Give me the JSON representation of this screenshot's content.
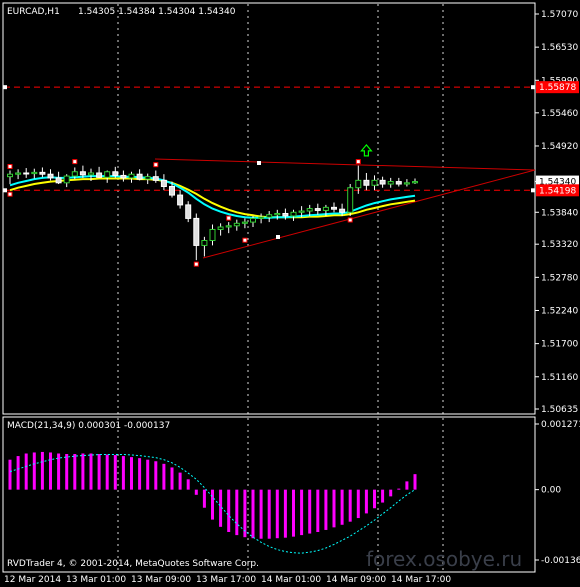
{
  "header": {
    "symbol_tf": "EURCAD,H1",
    "ohlc": "1.54305 1.54384 1.54304 1.54340"
  },
  "price_axis": {
    "ticks": [
      "1.57070",
      "1.56530",
      "1.55990",
      "1.55460",
      "1.54920",
      "1.54340",
      "1.53840",
      "1.53320",
      "1.52780",
      "1.52240",
      "1.51700",
      "1.51160",
      "1.50635"
    ],
    "tick_values": [
      1.5707,
      1.5653,
      1.5599,
      1.5546,
      1.5492,
      1.5434,
      1.5384,
      1.5332,
      1.5278,
      1.5224,
      1.517,
      1.5116,
      1.50635
    ],
    "current_price_label": "1.54340",
    "red_levels": [
      {
        "label": "1.55878",
        "value": 1.55878
      },
      {
        "label": "1.54198",
        "value": 1.54198
      }
    ]
  },
  "time_axis": {
    "labels": [
      "12 Mar 2014",
      "13 Mar 01:00",
      "13 Mar 09:00",
      "13 Mar 17:00",
      "14 Mar 01:00",
      "14 Mar 09:00",
      "14 Mar 17:00"
    ]
  },
  "macd": {
    "label": "MACD(21,34,9) 0.000301 -0.000137",
    "ticks": [
      "0.001271",
      "0.00",
      "-0.001362"
    ],
    "tick_values": [
      0.001271,
      0,
      -0.001362
    ]
  },
  "footer": {
    "copyright": "RVDTrader 4, © 2001-2014, MetaQuotes Software Corp.",
    "watermark": "forex.osobye.ru"
  },
  "colors": {
    "background": "#000000",
    "grid": "#ffffff",
    "bull_candle": "#32cd32",
    "bear_candle": "#e0e0e0",
    "level_line": "#ff0000",
    "ma_fast": "#00ffff",
    "ma_slow": "#ffff00",
    "macd_hist": "#ff00ff",
    "signal": "#00ffff",
    "arrow": "#00ff00"
  },
  "chart_data": [
    {
      "type": "candlestick",
      "title": "EURCAD,H1",
      "x": [
        "12 Mar 2014",
        "13 Mar 01:00",
        "13 Mar 09:00",
        "13 Mar 17:00",
        "14 Mar 01:00",
        "14 Mar 09:00",
        "14 Mar 17:00"
      ],
      "ylim": [
        1.50635,
        1.5707
      ],
      "candles": [
        {
          "o": 1.5442,
          "h": 1.5452,
          "l": 1.543,
          "c": 1.5446
        },
        {
          "o": 1.5446,
          "h": 1.5454,
          "l": 1.5438,
          "c": 1.5448
        },
        {
          "o": 1.5448,
          "h": 1.5456,
          "l": 1.544,
          "c": 1.5447
        },
        {
          "o": 1.5447,
          "h": 1.5455,
          "l": 1.5439,
          "c": 1.5449
        },
        {
          "o": 1.5449,
          "h": 1.5457,
          "l": 1.5441,
          "c": 1.5446
        },
        {
          "o": 1.5446,
          "h": 1.5454,
          "l": 1.5436,
          "c": 1.544
        },
        {
          "o": 1.544,
          "h": 1.545,
          "l": 1.543,
          "c": 1.5432
        },
        {
          "o": 1.5432,
          "h": 1.5446,
          "l": 1.5425,
          "c": 1.5443
        },
        {
          "o": 1.5443,
          "h": 1.5457,
          "l": 1.5438,
          "c": 1.545
        },
        {
          "o": 1.545,
          "h": 1.546,
          "l": 1.544,
          "c": 1.5445
        },
        {
          "o": 1.5445,
          "h": 1.5455,
          "l": 1.5435,
          "c": 1.5448
        },
        {
          "o": 1.5448,
          "h": 1.5458,
          "l": 1.544,
          "c": 1.5441
        },
        {
          "o": 1.5441,
          "h": 1.5452,
          "l": 1.5432,
          "c": 1.545
        },
        {
          "o": 1.545,
          "h": 1.5458,
          "l": 1.544,
          "c": 1.5444
        },
        {
          "o": 1.5444,
          "h": 1.5452,
          "l": 1.5434,
          "c": 1.544
        },
        {
          "o": 1.544,
          "h": 1.545,
          "l": 1.5432,
          "c": 1.5446
        },
        {
          "o": 1.5446,
          "h": 1.5454,
          "l": 1.5436,
          "c": 1.5438
        },
        {
          "o": 1.5438,
          "h": 1.5447,
          "l": 1.543,
          "c": 1.5442
        },
        {
          "o": 1.5442,
          "h": 1.5452,
          "l": 1.5432,
          "c": 1.5436
        },
        {
          "o": 1.5436,
          "h": 1.5446,
          "l": 1.542,
          "c": 1.5426
        },
        {
          "o": 1.5426,
          "h": 1.5434,
          "l": 1.5408,
          "c": 1.5412
        },
        {
          "o": 1.5412,
          "h": 1.542,
          "l": 1.539,
          "c": 1.5396
        },
        {
          "o": 1.5396,
          "h": 1.5402,
          "l": 1.5368,
          "c": 1.5374
        },
        {
          "o": 1.5374,
          "h": 1.5382,
          "l": 1.5306,
          "c": 1.533
        },
        {
          "o": 1.533,
          "h": 1.5344,
          "l": 1.5312,
          "c": 1.5338
        },
        {
          "o": 1.5338,
          "h": 1.5364,
          "l": 1.533,
          "c": 1.5356
        },
        {
          "o": 1.5356,
          "h": 1.5366,
          "l": 1.5346,
          "c": 1.536
        },
        {
          "o": 1.536,
          "h": 1.5368,
          "l": 1.535,
          "c": 1.5362
        },
        {
          "o": 1.5362,
          "h": 1.5372,
          "l": 1.5354,
          "c": 1.5366
        },
        {
          "o": 1.5366,
          "h": 1.5374,
          "l": 1.5358,
          "c": 1.5368
        },
        {
          "o": 1.5368,
          "h": 1.5378,
          "l": 1.536,
          "c": 1.5374
        },
        {
          "o": 1.5374,
          "h": 1.5382,
          "l": 1.5366,
          "c": 1.5376
        },
        {
          "o": 1.5376,
          "h": 1.5386,
          "l": 1.5368,
          "c": 1.538
        },
        {
          "o": 1.538,
          "h": 1.5388,
          "l": 1.5372,
          "c": 1.5382
        },
        {
          "o": 1.5382,
          "h": 1.539,
          "l": 1.5372,
          "c": 1.5378
        },
        {
          "o": 1.5378,
          "h": 1.5388,
          "l": 1.537,
          "c": 1.5384
        },
        {
          "o": 1.5384,
          "h": 1.5394,
          "l": 1.5376,
          "c": 1.5386
        },
        {
          "o": 1.5386,
          "h": 1.5396,
          "l": 1.5378,
          "c": 1.539
        },
        {
          "o": 1.539,
          "h": 1.5398,
          "l": 1.538,
          "c": 1.5387
        },
        {
          "o": 1.5387,
          "h": 1.5396,
          "l": 1.5378,
          "c": 1.5392
        },
        {
          "o": 1.5392,
          "h": 1.54,
          "l": 1.5384,
          "c": 1.5389
        },
        {
          "o": 1.5389,
          "h": 1.5398,
          "l": 1.5378,
          "c": 1.5384
        },
        {
          "o": 1.5384,
          "h": 1.543,
          "l": 1.5378,
          "c": 1.5424
        },
        {
          "o": 1.5424,
          "h": 1.546,
          "l": 1.5414,
          "c": 1.5436
        },
        {
          "o": 1.5436,
          "h": 1.5448,
          "l": 1.542,
          "c": 1.5428
        },
        {
          "o": 1.5428,
          "h": 1.5444,
          "l": 1.542,
          "c": 1.5436
        },
        {
          "o": 1.5436,
          "h": 1.5442,
          "l": 1.5424,
          "c": 1.543
        },
        {
          "o": 1.543,
          "h": 1.544,
          "l": 1.5424,
          "c": 1.5434
        },
        {
          "o": 1.5434,
          "h": 1.544,
          "l": 1.5426,
          "c": 1.543
        },
        {
          "o": 1.543,
          "h": 1.5438,
          "l": 1.5426,
          "c": 1.5432
        },
        {
          "o": 1.5432,
          "h": 1.5439,
          "l": 1.543,
          "c": 1.5434
        }
      ],
      "ma_fast": [
        1.5428,
        1.5432,
        1.5435,
        1.5438,
        1.544,
        1.5441,
        1.544,
        1.544,
        1.5441,
        1.5442,
        1.5443,
        1.5443,
        1.5443,
        1.5443,
        1.5442,
        1.5442,
        1.5441,
        1.544,
        1.5439,
        1.5436,
        1.5431,
        1.5424,
        1.5416,
        1.5406,
        1.5397,
        1.539,
        1.5385,
        1.5381,
        1.5378,
        1.5376,
        1.5375,
        1.5375,
        1.5375,
        1.5376,
        1.5376,
        1.5377,
        1.5378,
        1.5379,
        1.538,
        1.5381,
        1.5382,
        1.5382,
        1.5385,
        1.539,
        1.5395,
        1.5399,
        1.5402,
        1.5405,
        1.5407,
        1.5409,
        1.5411
      ],
      "ma_slow": [
        1.542,
        1.5424,
        1.5427,
        1.543,
        1.5432,
        1.5434,
        1.5435,
        1.5436,
        1.5437,
        1.5438,
        1.5438,
        1.5439,
        1.5439,
        1.5439,
        1.5439,
        1.5439,
        1.5438,
        1.5438,
        1.5437,
        1.5435,
        1.5432,
        1.5427,
        1.5421,
        1.5414,
        1.5406,
        1.5399,
        1.5393,
        1.5388,
        1.5384,
        1.5381,
        1.5379,
        1.5377,
        1.5376,
        1.5376,
        1.5376,
        1.5376,
        1.5376,
        1.5377,
        1.5377,
        1.5378,
        1.5379,
        1.5379,
        1.5381,
        1.5384,
        1.5388,
        1.5391,
        1.5394,
        1.5397,
        1.5399,
        1.5401,
        1.5403
      ],
      "levels": [
        1.55878,
        1.54198
      ],
      "fractals_up": [
        [
          0,
          1.5452
        ],
        [
          8,
          1.546
        ],
        [
          18,
          1.5455
        ],
        [
          27,
          1.5368
        ],
        [
          43,
          1.546
        ]
      ],
      "fractals_down": [
        [
          0,
          1.542
        ],
        [
          23,
          1.5306
        ],
        [
          29,
          1.5345
        ],
        [
          42,
          1.5378
        ]
      ],
      "buy_arrow_index": 44,
      "buy_arrow_price": 1.5484
    },
    {
      "type": "bar",
      "title": "MACD(21,34,9) 0.000301 -0.000137",
      "ylim": [
        -0.001362,
        0.001271
      ],
      "values": [
        0.00058,
        0.00065,
        0.0007,
        0.00072,
        0.00073,
        0.00072,
        0.0007,
        0.00069,
        0.00069,
        0.0007,
        0.0007,
        0.00069,
        0.00068,
        0.00067,
        0.00065,
        0.00063,
        0.00061,
        0.00058,
        0.00055,
        0.0005,
        0.00043,
        0.00033,
        0.0002,
        -0.0001,
        -0.00035,
        -0.00058,
        -0.00072,
        -0.00082,
        -0.00088,
        -0.00092,
        -0.00094,
        -0.00095,
        -0.00095,
        -0.00094,
        -0.00093,
        -0.00091,
        -0.00088,
        -0.00085,
        -0.00082,
        -0.00078,
        -0.00073,
        -0.00068,
        -0.00062,
        -0.00055,
        -0.00046,
        -0.00036,
        -0.00025,
        -0.00013,
        2e-05,
        0.00016,
        0.0003
      ],
      "signal": [
        0.00035,
        0.0004,
        0.00045,
        0.0005,
        0.00054,
        0.00058,
        0.00061,
        0.00063,
        0.00065,
        0.00066,
        0.00067,
        0.00068,
        0.00068,
        0.00068,
        0.00068,
        0.00067,
        0.00066,
        0.00064,
        0.00062,
        0.00058,
        0.00052,
        0.00043,
        0.00032,
        0.0002,
        4e-05,
        -0.00014,
        -0.00032,
        -0.0005,
        -0.00066,
        -0.0008,
        -0.00092,
        -0.00102,
        -0.0011,
        -0.00116,
        -0.0012,
        -0.00122,
        -0.00123,
        -0.00121,
        -0.00118,
        -0.00113,
        -0.00106,
        -0.00098,
        -0.0009,
        -0.0008,
        -0.0007,
        -0.00059,
        -0.00047,
        -0.00035,
        -0.00022,
        -0.0001,
        0.0
      ]
    }
  ]
}
